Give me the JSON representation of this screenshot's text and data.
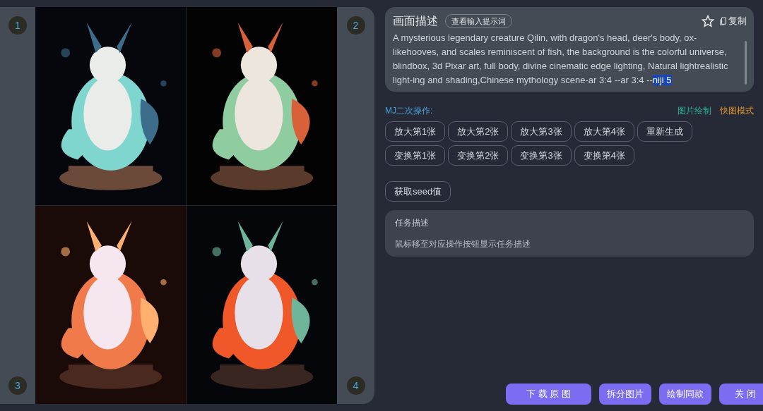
{
  "gallery": {
    "badges": [
      "1",
      "2",
      "3",
      "4"
    ],
    "images": [
      {
        "kind": "picture"
      },
      {
        "kind": "picture"
      },
      {
        "kind": "picture"
      },
      {
        "kind": "picture"
      }
    ]
  },
  "description": {
    "title": "画面描述",
    "view_prompt_button": "查看输入提示词",
    "copy_button": "复制",
    "favorited": false,
    "prompt_parts": [
      {
        "text": "A mysterious legendary creature Qilin, with dragon's head, deer's body, ox-likehooves, and scales reminiscent of fish, the background is the colorful universe, blindbox, 3d Pixar art, full body, divine cinematic edge lighting, Natural lightrealistic light-ing and shading,Chinese mythology scene-ar 3:4 --ar 3:4 --",
        "selected": false
      },
      {
        "text": "niji 5",
        "selected": true
      }
    ]
  },
  "operations": {
    "label": "MJ二次操作:",
    "mode_links": [
      {
        "text": "图片绘制",
        "color": "#2fb59a"
      },
      {
        "text": "快图模式",
        "color": "#e0962c"
      }
    ],
    "button_rows": [
      [
        "放大第1张",
        "放大第2张",
        "放大第3张",
        "放大第4张",
        "重新生成"
      ],
      [
        "变换第1张",
        "变换第2张",
        "变换第3张",
        "变换第4张"
      ]
    ],
    "seed_button": "获取seed值"
  },
  "task": {
    "title": "任务描述",
    "hint": "鼠标移至对应操作按钮显示任务描述"
  },
  "footer_buttons": [
    "下 载 原 图",
    "拆分图片",
    "绘制同款",
    "关 闭"
  ]
}
